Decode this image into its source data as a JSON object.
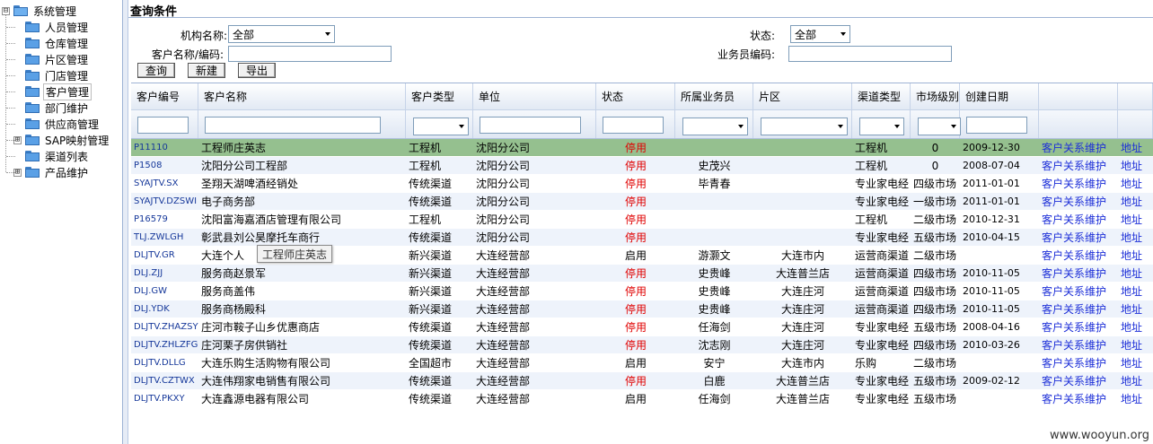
{
  "sidebar": {
    "root": {
      "label": "系统管理",
      "expander": "⊟"
    },
    "items": [
      {
        "label": "人员管理"
      },
      {
        "label": "仓库管理"
      },
      {
        "label": "片区管理"
      },
      {
        "label": "门店管理"
      },
      {
        "label": "客户管理",
        "selected": true
      },
      {
        "label": "部门维护"
      },
      {
        "label": "供应商管理"
      },
      {
        "label": "SAP映射管理",
        "expander": "⊞"
      },
      {
        "label": "渠道列表"
      },
      {
        "label": "产品维护",
        "expander": "⊞"
      }
    ]
  },
  "query": {
    "title": "查询条件",
    "org_label": "机构名称:",
    "org_value": "全部",
    "customer_label": "客户名称/编码:",
    "customer_value": "",
    "status_label": "状态:",
    "status_value": "全部",
    "salesman_label": "业务员编码:",
    "salesman_value": "",
    "buttons": {
      "search": "查询",
      "new": "新建",
      "export": "导出"
    }
  },
  "grid": {
    "columns": [
      "客户编号",
      "客户名称",
      "客户类型",
      "单位",
      "状态",
      "所属业务员",
      "片区",
      "渠道类型",
      "市场级别",
      "创建日期",
      "",
      ""
    ],
    "rows": [
      [
        "P11110",
        "工程师庄英志",
        "工程机",
        "沈阳分公司",
        "停用",
        "",
        "",
        "工程机",
        "0",
        "2009-12-30",
        "客户关系维护",
        "地址"
      ],
      [
        "P1508",
        "沈阳分公司工程部",
        "工程机",
        "沈阳分公司",
        "停用",
        "史茂兴",
        "",
        "工程机",
        "0",
        "2008-07-04",
        "客户关系维护",
        "地址"
      ],
      [
        "SYAJTV.SX",
        "圣翔天湖啤酒经销处",
        "传统渠道",
        "沈阳分公司",
        "停用",
        "毕青春",
        "",
        "专业家电经",
        "四级市场",
        "2011-01-01",
        "客户关系维护",
        "地址"
      ],
      [
        "SYAJTV.DZSWI",
        "电子商务部",
        "传统渠道",
        "沈阳分公司",
        "停用",
        "",
        "",
        "专业家电经",
        "一级市场",
        "2011-01-01",
        "客户关系维护",
        "地址"
      ],
      [
        "P16579",
        "沈阳富海嘉酒店管理有限公司",
        "工程机",
        "沈阳分公司",
        "停用",
        "",
        "",
        "工程机",
        "二级市场",
        "2010-12-31",
        "客户关系维护",
        "地址"
      ],
      [
        "TLJ.ZWLGH",
        "彰武县刘公昊摩托车商行",
        "传统渠道",
        "沈阳分公司",
        "停用",
        "",
        "",
        "专业家电经",
        "五级市场",
        "2010-04-15",
        "客户关系维护",
        "地址"
      ],
      [
        "DLJTV.GR",
        "大连个人",
        "新兴渠道",
        "大连经营部",
        "启用",
        "游灏文",
        "大连市内",
        "运营商渠道",
        "二级市场",
        "",
        "客户关系维护",
        "地址"
      ],
      [
        "DLJ.ZJJ",
        "服务商赵景军",
        "新兴渠道",
        "大连经营部",
        "停用",
        "史贵峰",
        "大连普兰店",
        "运营商渠道",
        "四级市场",
        "2010-11-05",
        "客户关系维护",
        "地址"
      ],
      [
        "DLJ.GW",
        "服务商盖伟",
        "新兴渠道",
        "大连经营部",
        "停用",
        "史贵峰",
        "大连庄河",
        "运营商渠道",
        "四级市场",
        "2010-11-05",
        "客户关系维护",
        "地址"
      ],
      [
        "DLJ.YDK",
        "服务商杨殿科",
        "新兴渠道",
        "大连经营部",
        "停用",
        "史贵峰",
        "大连庄河",
        "运营商渠道",
        "四级市场",
        "2010-11-05",
        "客户关系维护",
        "地址"
      ],
      [
        "DLJTV.ZHAZSY",
        "庄河市鞍子山乡优惠商店",
        "传统渠道",
        "大连经营部",
        "停用",
        "任海剑",
        "大连庄河",
        "专业家电经",
        "五级市场",
        "2008-04-16",
        "客户关系维护",
        "地址"
      ],
      [
        "DLJTV.ZHLZFG",
        "庄河栗子房供销社",
        "传统渠道",
        "大连经营部",
        "停用",
        "沈志刚",
        "大连庄河",
        "专业家电经",
        "四级市场",
        "2010-03-26",
        "客户关系维护",
        "地址"
      ],
      [
        "DLJTV.DLLG",
        "大连乐购生活购物有限公司",
        "全国超市",
        "大连经营部",
        "启用",
        "安宁",
        "大连市内",
        "乐购",
        "二级市场",
        "",
        "客户关系维护",
        "地址"
      ],
      [
        "DLJTV.CZTWX",
        "大连伟翔家电销售有限公司",
        "传统渠道",
        "大连经营部",
        "停用",
        "白鹿",
        "大连普兰店",
        "专业家电经",
        "五级市场",
        "2009-02-12",
        "客户关系维护",
        "地址"
      ],
      [
        "DLJTV.PKXY",
        "大连鑫源电器有限公司",
        "传统渠道",
        "大连经营部",
        "启用",
        "任海剑",
        "大连普兰店",
        "专业家电经",
        "五级市场",
        "",
        "客户关系维护",
        "地址"
      ]
    ],
    "tooltip": "工程师庄英志"
  },
  "watermark": "www.wooyun.org",
  "colors": {
    "highlight_row": "#95c08f",
    "status_red": "#e00000",
    "link_blue": "#1d2fd8",
    "code_blue": "#16389a"
  }
}
